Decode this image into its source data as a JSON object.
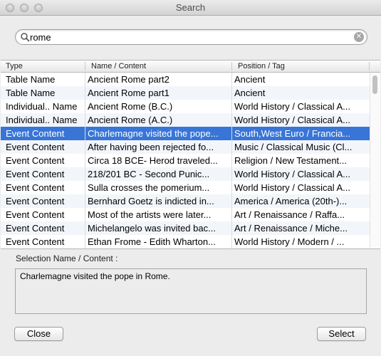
{
  "window": {
    "title": "Search"
  },
  "search": {
    "value": "rome",
    "placeholder": ""
  },
  "table": {
    "columns": [
      "Type",
      "Name / Content",
      "Position / Tag"
    ],
    "rows": [
      [
        "Table Name",
        "Ancient Rome part2",
        "Ancient"
      ],
      [
        "Table Name",
        "Ancient Rome part1",
        "Ancient"
      ],
      [
        "Individual.. Name",
        "Ancient Rome (B.C.)",
        "World History  / Classical A..."
      ],
      [
        "Individual.. Name",
        "Ancient Rome (A.C.)",
        "World History  / Classical A..."
      ],
      [
        "Event Content",
        "Charlemagne visited the pope...",
        "South,West Euro  / Francia..."
      ],
      [
        "Event Content",
        "After having been rejected fo...",
        "Music  / Classical Music (Cl..."
      ],
      [
        "Event Content",
        "Circa 18 BCE- Herod traveled...",
        "Religion  / New Testament..."
      ],
      [
        "Event Content",
        "218/201 BC -  Second Punic...",
        "World History  / Classical A..."
      ],
      [
        "Event Content",
        "Sulla crosses the pomerium...",
        "World History  / Classical A..."
      ],
      [
        "Event Content",
        "Bernhard Goetz is indicted in...",
        "America  / America (20th-)..."
      ],
      [
        "Event Content",
        "Most of the artists were later...",
        "Art  / Renaissance  / Raffa..."
      ],
      [
        "Event Content",
        "Michelangelo was invited bac...",
        "Art  / Renaissance  / Miche..."
      ],
      [
        "Event Content",
        "Ethan Frome - Edith Wharton...",
        "World History  / Modern  / ..."
      ]
    ],
    "selected_index": 4
  },
  "selection": {
    "label": "Selection Name / Content :",
    "text": "Charlemagne visited the pope in Rome."
  },
  "buttons": {
    "close": "Close",
    "select": "Select"
  },
  "colors": {
    "selection": "#3875d7",
    "alt_row": "#f2f6fb"
  }
}
